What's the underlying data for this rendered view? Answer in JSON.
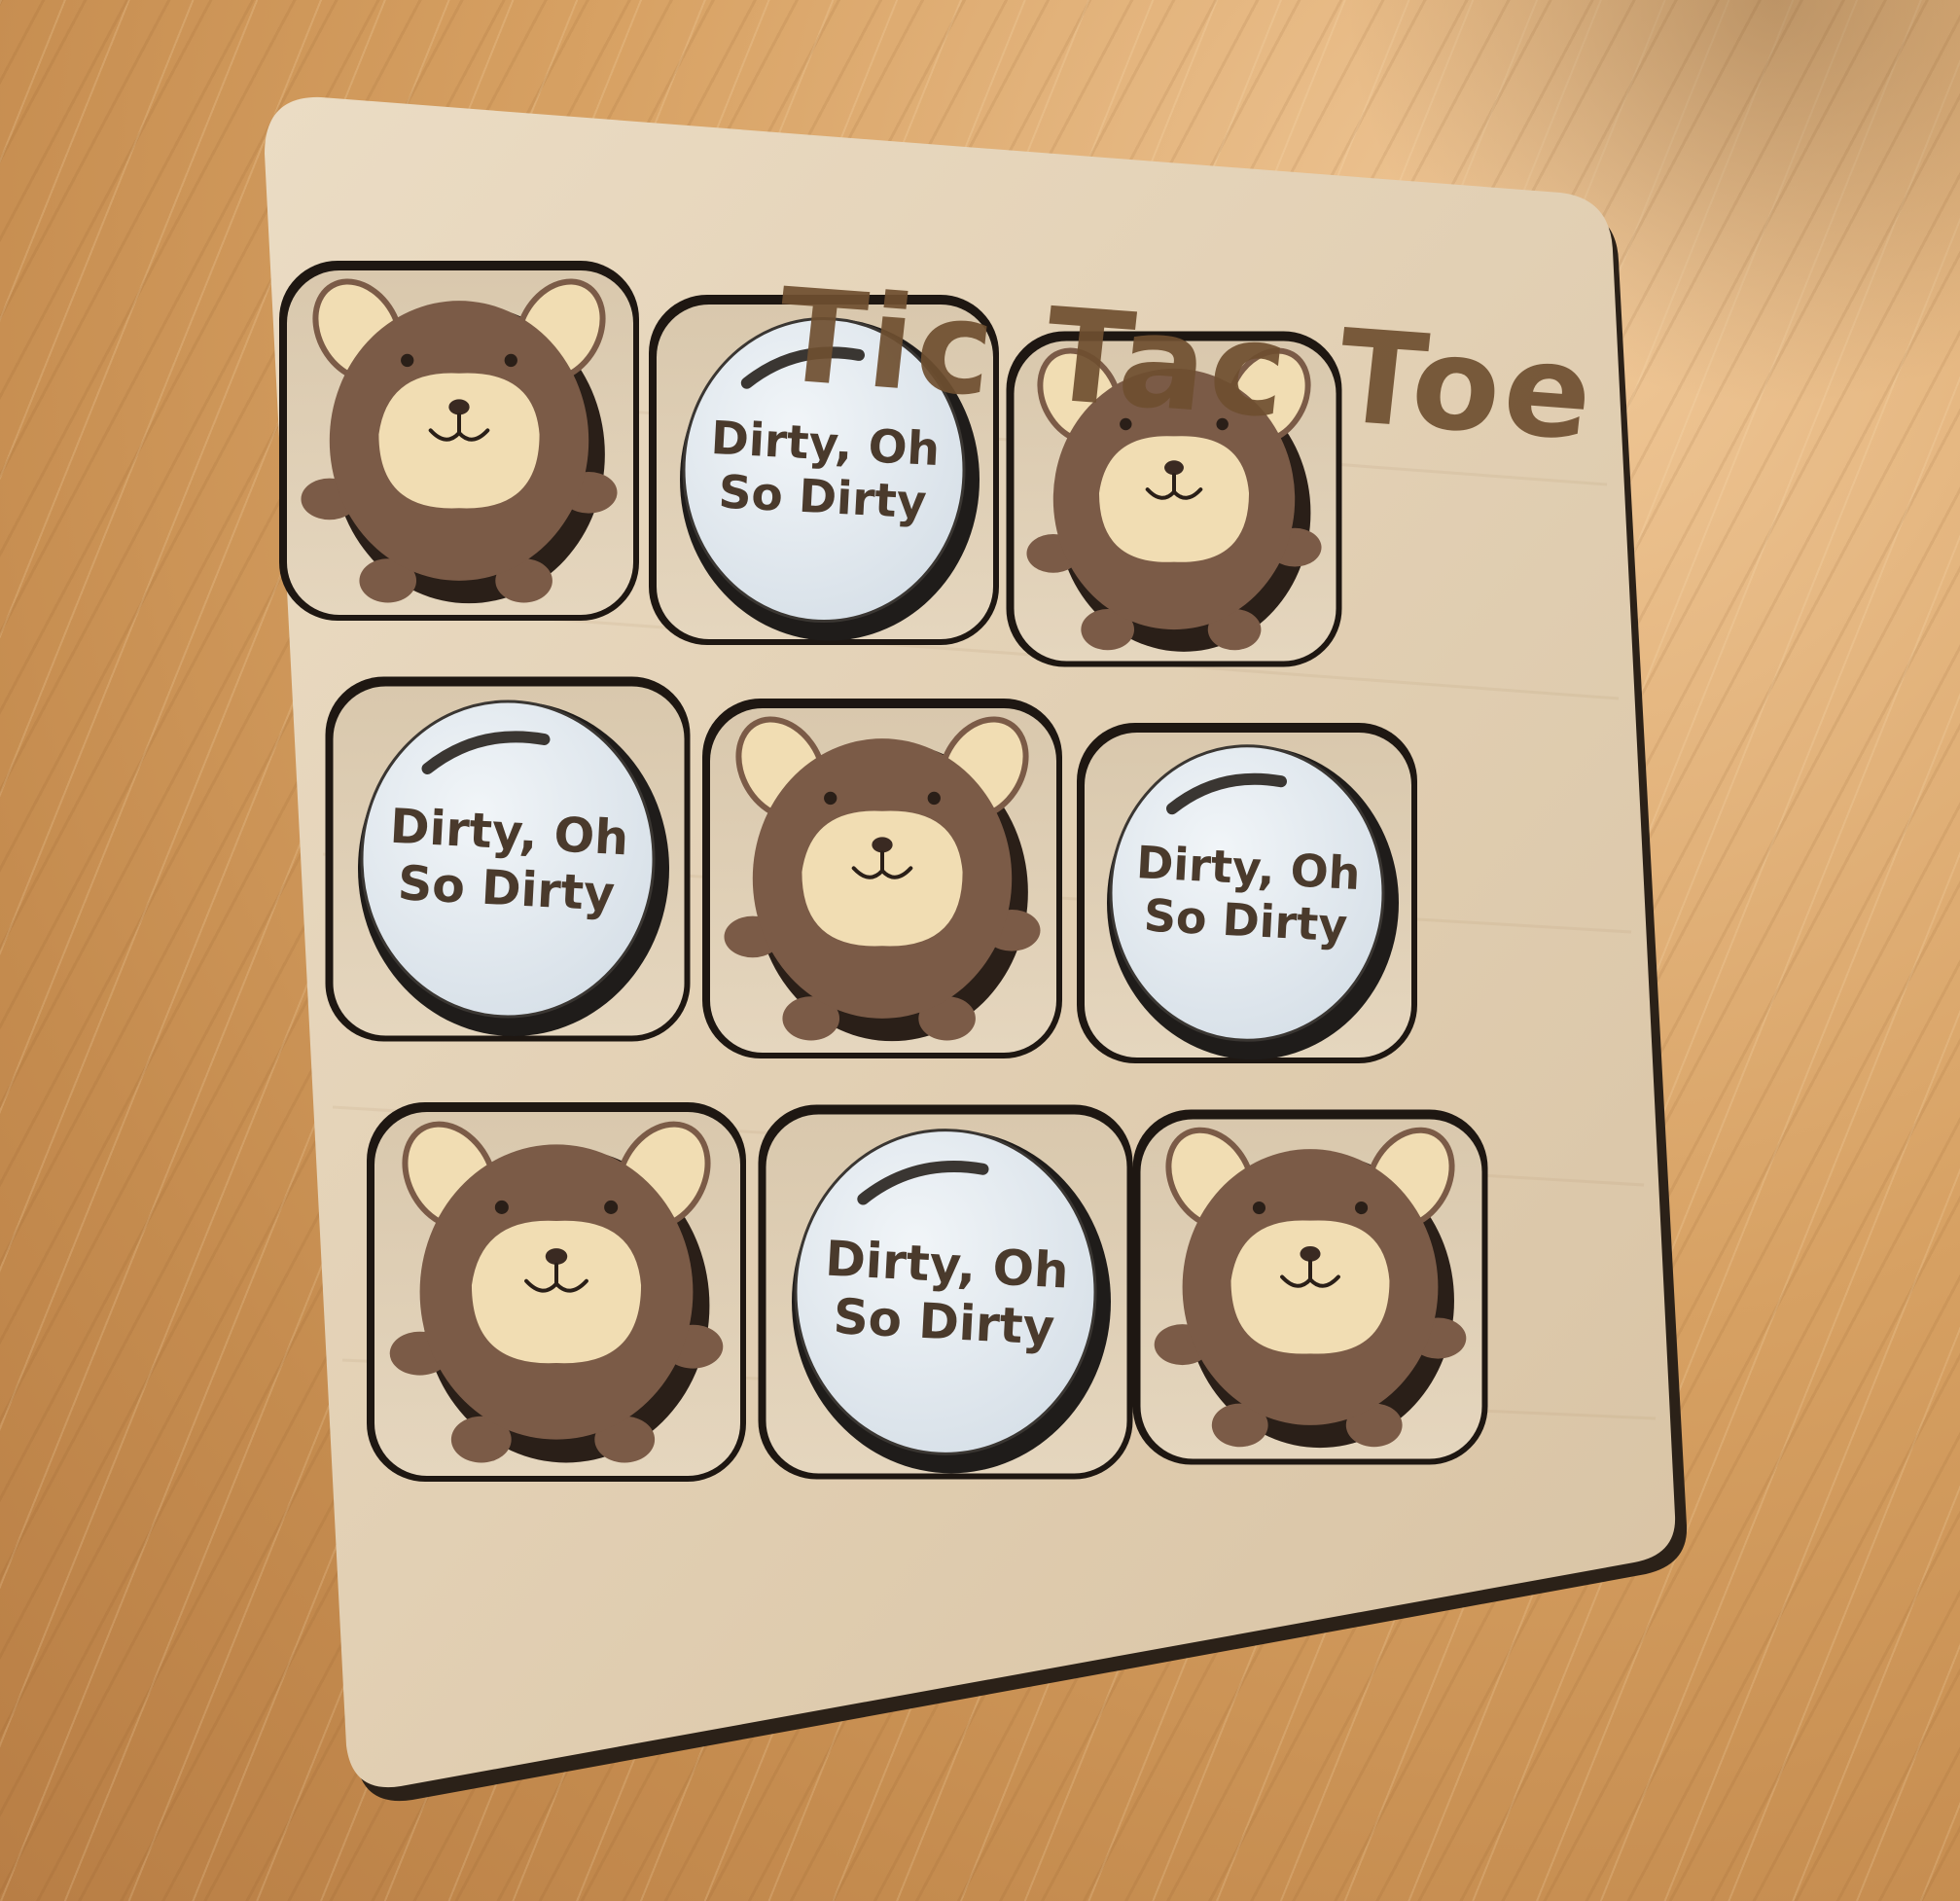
{
  "board": {
    "title": "Tic Tac Toe"
  },
  "cells": [
    {
      "row": 1,
      "col": 1,
      "piece": "bear"
    },
    {
      "row": 1,
      "col": 2,
      "piece": "bubble",
      "line1": "Dirty, Oh",
      "line2": "So Dirty"
    },
    {
      "row": 1,
      "col": 3,
      "piece": "bear"
    },
    {
      "row": 2,
      "col": 1,
      "piece": "bubble",
      "line1": "Dirty, Oh",
      "line2": "So Dirty"
    },
    {
      "row": 2,
      "col": 2,
      "piece": "bear"
    },
    {
      "row": 2,
      "col": 3,
      "piece": "bubble",
      "line1": "Dirty, Oh",
      "line2": "So Dirty"
    },
    {
      "row": 3,
      "col": 1,
      "piece": "bear"
    },
    {
      "row": 3,
      "col": 2,
      "piece": "bubble",
      "line1": "Dirty, Oh",
      "line2": "So Dirty"
    },
    {
      "row": 3,
      "col": 3,
      "piece": "bear"
    }
  ],
  "colors": {
    "board_wood": "#e4d3b8",
    "board_edge": "#2b2118",
    "bear_body": "#7b5b47",
    "bear_face": "#f1ddb3",
    "bubble_fill": "#e6edf2",
    "bubble_rim": "#1f1c1a",
    "engraving": "#6f4f30"
  }
}
